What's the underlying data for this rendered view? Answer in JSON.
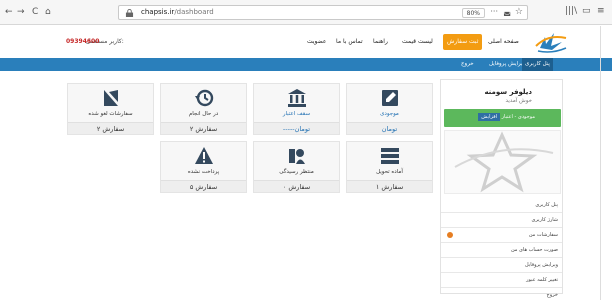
{
  "browser": {
    "url_domain": "chapsis.ir",
    "url_path": "/dashboard",
    "zoom": "80%",
    "more": "···",
    "nav": {
      "back": "←",
      "forward": "→",
      "reload": "C",
      "home": "⌂"
    },
    "right_icons": [
      "|||\\",
      "▭",
      "≡"
    ]
  },
  "header": {
    "user_label": "کاربر مستعمل:",
    "user_name": "09394600",
    "menu": [
      {
        "label": "صفحه اصلی",
        "active": false
      },
      {
        "label": "ثبت سفارش",
        "active": true
      },
      {
        "label": "لیست قیمت",
        "active": false
      },
      {
        "label": "راهنما",
        "active": false
      },
      {
        "label": "تماس با ما",
        "active": false
      },
      {
        "label": "عضویت",
        "active": false
      }
    ]
  },
  "bluebar": {
    "links": [
      "پنل کاربری",
      "ویرایش پروفایل",
      "خروج"
    ]
  },
  "sidebar": {
    "name": "دیلوفر سومنه",
    "role": "خوش آمدید",
    "switch_left": "موجودی",
    "switch_sep": "-",
    "switch_mid": "اعتبار",
    "switch_on": "افزایش",
    "items": [
      {
        "label": "پنل کاربری",
        "badge": false
      },
      {
        "label": "شارژ کاربری",
        "badge": false
      },
      {
        "label": "سفارشات من",
        "badge": true
      },
      {
        "label": "صورت حساب های من",
        "badge": false
      },
      {
        "label": "ویرایش پروفایل",
        "badge": false
      },
      {
        "label": "تغییر کلمه عبور",
        "badge": false
      },
      {
        "label": "خروج",
        "badge": false
      }
    ]
  },
  "tiles": [
    {
      "title": "موجودی",
      "value": "تومان",
      "icon": "edit-icon",
      "blue": true
    },
    {
      "title": "سقف اعتبار",
      "value": "-----تومان",
      "icon": "bank-icon",
      "blue": true
    },
    {
      "title": "در حال انجام",
      "value": "۲ سفارش",
      "icon": "history-icon",
      "blue": false
    },
    {
      "title": "سفارشات لغو شده",
      "value": "۲ سفارش",
      "icon": "cancel-icon",
      "blue": false
    },
    {
      "title": "آماده تحویل",
      "value": "۱ سفارش",
      "icon": "list-icon",
      "blue": false
    },
    {
      "title": "منتظر رسیدگی",
      "value": "۰ سفارش",
      "icon": "user-wait-icon",
      "blue": false
    },
    {
      "title": "پرداخت نشده",
      "value": "۵ سفارش",
      "icon": "warning-icon",
      "blue": false
    }
  ],
  "colors": {
    "accent_blue": "#2a7fbb",
    "menu_active": "#f39c12",
    "green": "#5cb85c",
    "user_name_red": "#c62828"
  }
}
